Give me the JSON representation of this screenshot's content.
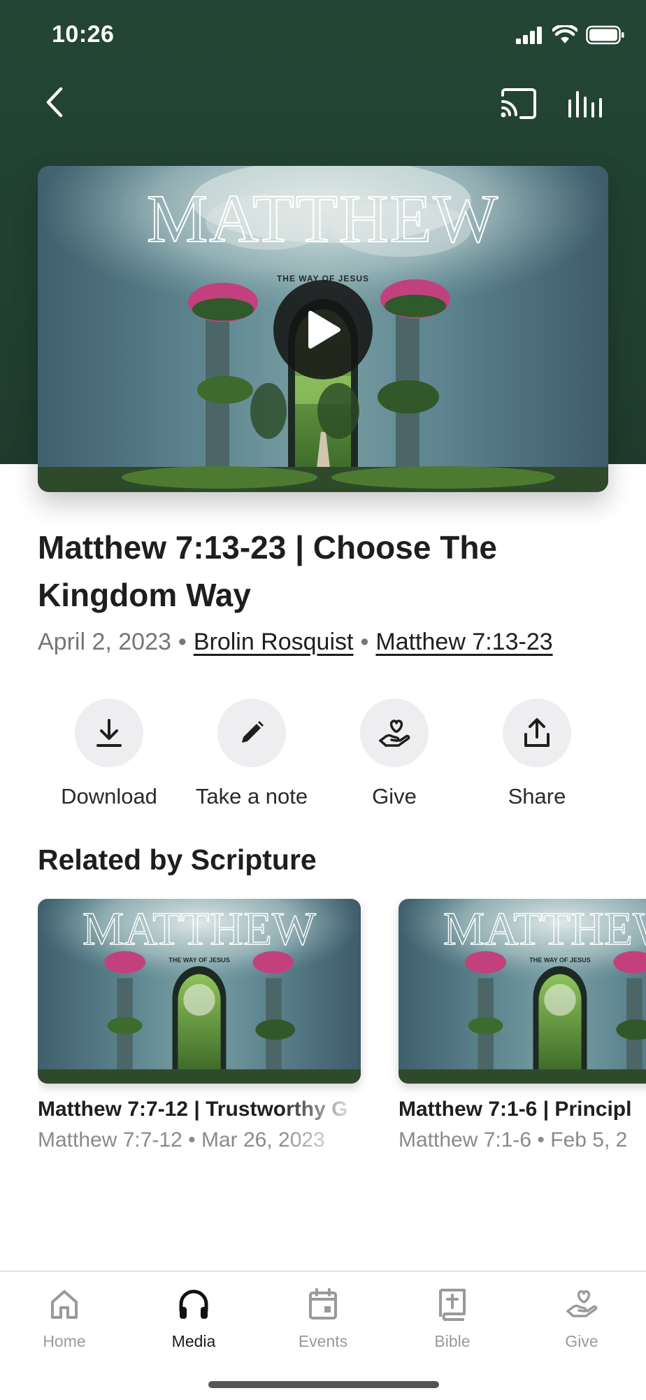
{
  "status": {
    "time": "10:26"
  },
  "colors": {
    "header": "#21402f",
    "accent": "#1b1b1b",
    "muted": "#9a9a9a"
  },
  "nav": {
    "back_icon": "chevron-left-icon",
    "cast_icon": "cast-icon",
    "audio_icon": "audio-bars-icon"
  },
  "hero": {
    "art_title": "MATTHEW",
    "art_subtitle": "THE WAY OF JESUS",
    "play_icon": "play-icon"
  },
  "sermon": {
    "title": "Matthew 7:13-23 | Choose The Kingdom Way",
    "date": "April 2, 2023",
    "speaker": "Brolin Rosquist",
    "scripture": "Matthew 7:13-23"
  },
  "actions": [
    {
      "label": "Download",
      "icon": "download-icon"
    },
    {
      "label": "Take a note",
      "icon": "pencil-icon"
    },
    {
      "label": "Give",
      "icon": "give-hand-heart-icon"
    },
    {
      "label": "Share",
      "icon": "share-icon"
    }
  ],
  "related": {
    "title": "Related by Scripture",
    "items": [
      {
        "art_title": "MATTHEW",
        "art_subtitle": "THE WAY OF JESUS",
        "title": "Matthew 7:7-12 | Trustworthy G",
        "scripture": "Matthew 7:7-12",
        "date": "Mar 26, 2023"
      },
      {
        "art_title": "MATTHEW",
        "art_subtitle": "THE WAY OF JESUS",
        "title": "Matthew 7:1-6 | Principl",
        "scripture": "Matthew 7:1-6",
        "date": "Feb 5, 2"
      }
    ]
  },
  "tabs": [
    {
      "label": "Home",
      "icon": "home-icon",
      "active": false
    },
    {
      "label": "Media",
      "icon": "headphones-icon",
      "active": true
    },
    {
      "label": "Events",
      "icon": "calendar-icon",
      "active": false
    },
    {
      "label": "Bible",
      "icon": "bible-icon",
      "active": false
    },
    {
      "label": "Give",
      "icon": "give-hand-heart-icon",
      "active": false
    }
  ]
}
